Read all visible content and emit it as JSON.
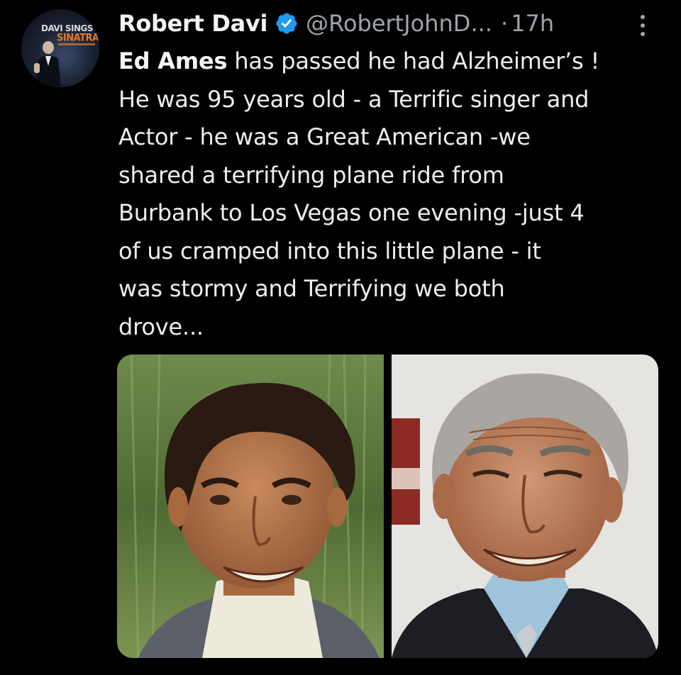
{
  "author": {
    "display_name": "Robert Davi",
    "handle": "@RobertJohnD...",
    "separator": "·",
    "timestamp": "17h",
    "verified": true,
    "verified_icon": "verified-badge-icon",
    "avatar": {
      "line1": "DAVI SINGS",
      "line2": "SINATRA"
    }
  },
  "tweet": {
    "bold_name": "Ed Ames",
    "text_after_name": " has passed he had Alzheimer’s !\nHe was 95 years old - a Terrific singer and\nActor - he was a Great American -we\nshared a terrifying plane ride from\nBurbank to Los Vegas one evening -just 4\nof us cramped into this little plane - it\nwas stormy and Terrifying we both\ndrove..."
  },
  "media": {
    "photos": [
      {
        "name": "young-portrait"
      },
      {
        "name": "older-portrait"
      }
    ]
  },
  "colors": {
    "background": "#000000",
    "text": "#e7e9ea",
    "secondary_text": "#9ea4aa",
    "verified_blue": "#1d9bf0"
  }
}
